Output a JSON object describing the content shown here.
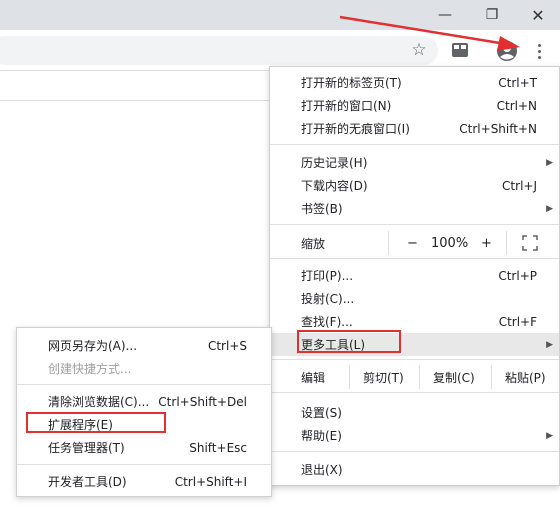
{
  "window": {
    "minimize_glyph": "—",
    "maximize_glyph": "❐",
    "close_glyph": "✕"
  },
  "toolbar": {
    "star_glyph": "☆",
    "icons": [
      "bookmark-star-icon",
      "extension-icon",
      "profile-icon",
      "more-menu-icon"
    ]
  },
  "menu": {
    "items": [
      {
        "label": "打开新的标签页(T)",
        "shortcut": "Ctrl+T"
      },
      {
        "label": "打开新的窗口(N)",
        "shortcut": "Ctrl+N"
      },
      {
        "label": "打开新的无痕窗口(I)",
        "shortcut": "Ctrl+Shift+N"
      },
      {
        "label": "历史记录(H)",
        "shortcut": ""
      },
      {
        "label": "下载内容(D)",
        "shortcut": "Ctrl+J"
      },
      {
        "label": "书签(B)",
        "shortcut": ""
      },
      {
        "label": "打印(P)...",
        "shortcut": "Ctrl+P"
      },
      {
        "label": "投射(C)...",
        "shortcut": ""
      },
      {
        "label": "查找(F)...",
        "shortcut": "Ctrl+F"
      },
      {
        "label": "更多工具(L)",
        "shortcut": ""
      },
      {
        "label": "设置(S)",
        "shortcut": ""
      },
      {
        "label": "帮助(E)",
        "shortcut": ""
      },
      {
        "label": "退出(X)",
        "shortcut": ""
      }
    ],
    "zoom": {
      "label": "缩放",
      "minus": "−",
      "value": "100%",
      "plus": "+"
    },
    "edit": {
      "label": "编辑",
      "cut": "剪切(T)",
      "copy": "复制(C)",
      "paste": "粘贴(P)"
    },
    "submenu_arrow": "▶"
  },
  "submenu": {
    "items": [
      {
        "label": "网页另存为(A)...",
        "shortcut": "Ctrl+S"
      },
      {
        "label": "创建快捷方式...",
        "shortcut": ""
      },
      {
        "label": "清除浏览数据(C)...",
        "shortcut": "Ctrl+Shift+Del"
      },
      {
        "label": "扩展程序(E)",
        "shortcut": ""
      },
      {
        "label": "任务管理器(T)",
        "shortcut": "Shift+Esc"
      },
      {
        "label": "开发者工具(D)",
        "shortcut": "Ctrl+Shift+I"
      }
    ]
  },
  "colors": {
    "annotation_red": "#e03030",
    "highlight": "#e8e8e8",
    "titlebar": "#dee1e6"
  }
}
